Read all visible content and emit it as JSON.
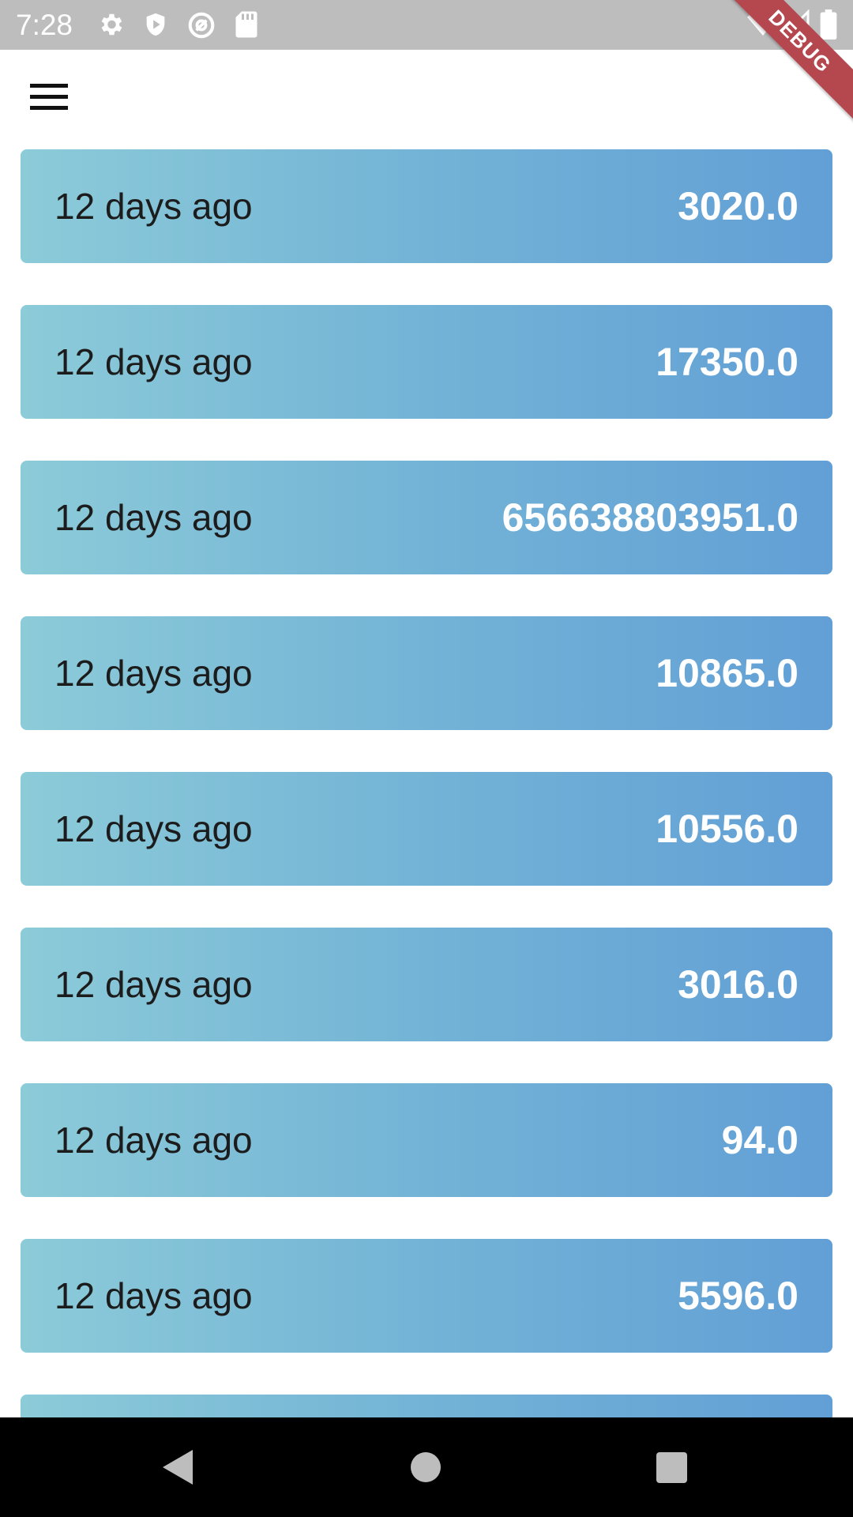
{
  "status_bar": {
    "time": "7:28",
    "icons_left": [
      "settings-icon",
      "shield-icon",
      "at-sign-icon",
      "sd-card-icon"
    ],
    "icons_right": [
      "wifi-icon",
      "cell-signal-icon",
      "battery-icon"
    ]
  },
  "debug_banner": {
    "label": "DEBUG",
    "color": "#b5474e"
  },
  "app_bar": {
    "menu_icon": "menu-icon"
  },
  "transactions": [
    {
      "date": "12 days ago",
      "amount": "3020.0"
    },
    {
      "date": "12 days ago",
      "amount": "17350.0"
    },
    {
      "date": "12 days ago",
      "amount": "656638803951.0"
    },
    {
      "date": "12 days ago",
      "amount": "10865.0"
    },
    {
      "date": "12 days ago",
      "amount": "10556.0"
    },
    {
      "date": "12 days ago",
      "amount": "3016.0"
    },
    {
      "date": "12 days ago",
      "amount": "94.0"
    },
    {
      "date": "12 days ago",
      "amount": "5596.0"
    },
    {
      "date": "",
      "amount": ""
    }
  ],
  "colors": {
    "card_gradient_start": "#8ccbd8",
    "card_gradient_end": "#629fd6",
    "status_bar": "#bdbdbd",
    "nav_bar": "#000000"
  },
  "nav_bar": {
    "icons": [
      "back-icon",
      "home-icon",
      "recents-icon"
    ]
  }
}
